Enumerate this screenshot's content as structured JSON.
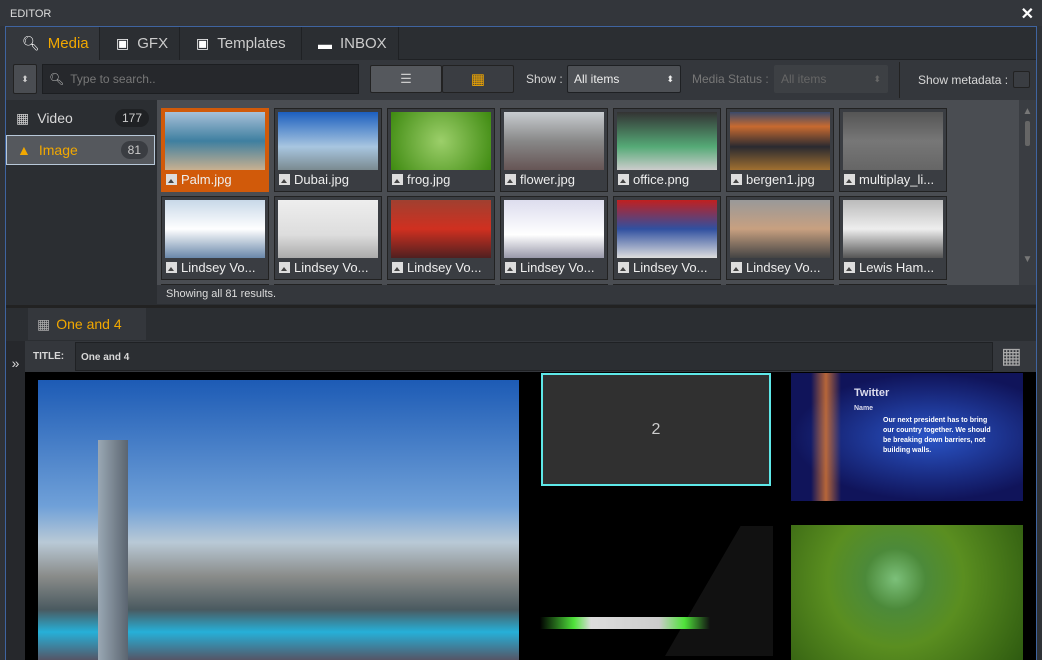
{
  "window": {
    "title": "EDITOR",
    "close_icon": "close-icon"
  },
  "tabs": [
    {
      "label": "Media",
      "icon": "search-icon",
      "active": true
    },
    {
      "label": "GFX",
      "icon": "gfx-icon"
    },
    {
      "label": "Templates",
      "icon": "template-icon"
    },
    {
      "label": "INBOX",
      "icon": "folder-icon"
    }
  ],
  "toolbar": {
    "search_placeholder": "Type to search..",
    "show_label": "Show :",
    "show_value": "All items",
    "media_status_label": "Media Status :",
    "media_status_value": "All items",
    "show_metadata_label": "Show metadata :",
    "show_metadata_checked": false,
    "view_mode": "grid"
  },
  "sidebar": [
    {
      "label": "Video",
      "count": "177",
      "icon": "film-icon"
    },
    {
      "label": "Image",
      "count": "81",
      "icon": "image-icon",
      "active": true
    }
  ],
  "grid": {
    "items": [
      {
        "name": "Palm.jpg",
        "selected": true
      },
      {
        "name": "Dubai.jpg"
      },
      {
        "name": "frog.jpg"
      },
      {
        "name": "flower.jpg"
      },
      {
        "name": "office.png"
      },
      {
        "name": "bergen1.jpg"
      },
      {
        "name": "multiplay_li..."
      },
      {
        "name": "Lindsey Vo..."
      },
      {
        "name": "Lindsey Vo..."
      },
      {
        "name": "Lindsey Vo..."
      },
      {
        "name": "Lindsey Vo..."
      },
      {
        "name": "Lindsey Vo..."
      },
      {
        "name": "Lindsey Vo..."
      },
      {
        "name": "Lewis Ham..."
      }
    ],
    "status": "Showing all 81 results."
  },
  "layout": {
    "tab_label": "One and 4",
    "title_label": "TITLE:",
    "title_value": "One and 4",
    "expand_icon": "double-chevron-right-icon",
    "slot2_label": "2",
    "twitter": {
      "heading": "Twitter",
      "name_label": "Name",
      "text": "Our next president has to bring our country together. We should be breaking down barriers, not building walls."
    }
  },
  "colors": {
    "accent": "#f2a800",
    "selected": "#d15a0a",
    "slot_border": "#5ee8e8",
    "panel_border": "#3f64a0"
  }
}
